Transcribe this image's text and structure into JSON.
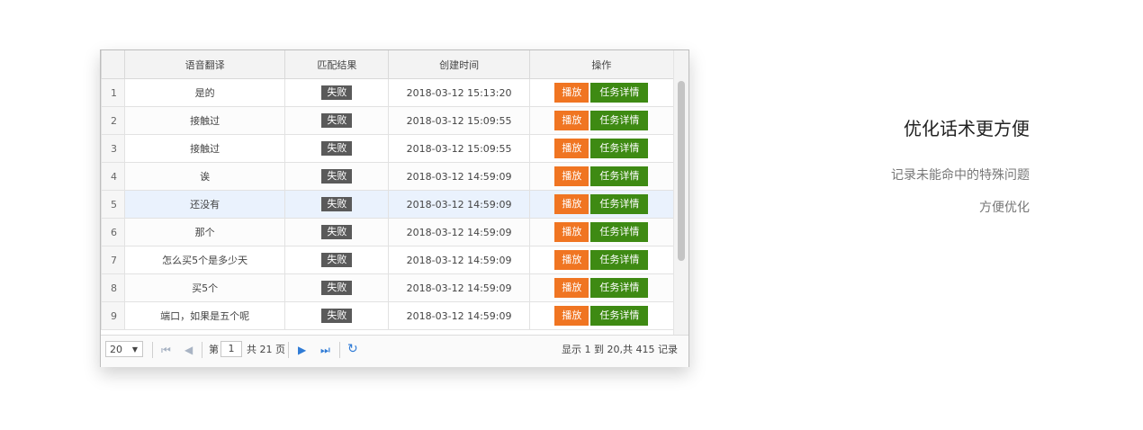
{
  "table": {
    "columns": [
      "",
      "语音翻译",
      "匹配结果",
      "创建时间",
      "操作"
    ],
    "rows": [
      {
        "num": "1",
        "text": "是的",
        "result": "失败",
        "time": "2018-03-12 15:13:20"
      },
      {
        "num": "2",
        "text": "接触过",
        "result": "失败",
        "time": "2018-03-12 15:09:55"
      },
      {
        "num": "3",
        "text": "接触过",
        "result": "失败",
        "time": "2018-03-12 15:09:55"
      },
      {
        "num": "4",
        "text": "诶",
        "result": "失败",
        "time": "2018-03-12 14:59:09"
      },
      {
        "num": "5",
        "text": "还没有",
        "result": "失败",
        "time": "2018-03-12 14:59:09"
      },
      {
        "num": "6",
        "text": "那个",
        "result": "失败",
        "time": "2018-03-12 14:59:09"
      },
      {
        "num": "7",
        "text": "怎么买5个是多少天",
        "result": "失败",
        "time": "2018-03-12 14:59:09"
      },
      {
        "num": "8",
        "text": "买5个",
        "result": "失败",
        "time": "2018-03-12 14:59:09"
      },
      {
        "num": "9",
        "text": "端口，如果是五个呢",
        "result": "失败",
        "time": "2018-03-12 14:59:09"
      }
    ],
    "play_label": "播放",
    "detail_label": "任务详情",
    "highlighted_row": 5
  },
  "pager": {
    "page_size": "20",
    "page_prefix": "第",
    "page_value": "1",
    "page_suffix": "共 21 页",
    "summary": "显示 1 到 20,共 415 记录"
  },
  "promo": {
    "title": "优化话术更方便",
    "line1": "记录未能命中的特殊问题",
    "line2": "方便优化"
  },
  "colors": {
    "play": "#f07522",
    "detail": "#3e8a13",
    "badge": "#5a5a5a",
    "highlight": "#eaf2fd"
  }
}
